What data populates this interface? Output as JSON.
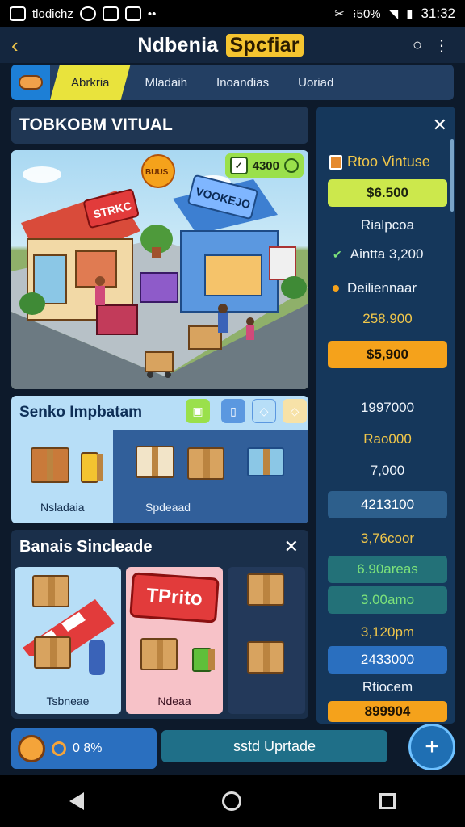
{
  "status_bar": {
    "app_label": "tlodichz",
    "battery": "⁝50%",
    "time": "31:32"
  },
  "header": {
    "title_main": "Ndbenia",
    "title_highlight": "Spcfiar"
  },
  "tabs": [
    {
      "label": "Abrkria"
    },
    {
      "label": "Mladaih"
    },
    {
      "label": "Inoandias"
    },
    {
      "label": "Uoriad"
    }
  ],
  "main": {
    "section_title": "TOBKOBM VITUAL",
    "scene": {
      "currency": "4300",
      "shop_sign": "STRKC",
      "sun_badge": "BUUS",
      "store_sign": "VOOKEJO"
    },
    "panel_a": {
      "title": "Senko Impbatam",
      "label_left": "Nsladaia",
      "label_right": "Spdeaad"
    },
    "panel_b": {
      "title": "Banais Sincleade",
      "badge": "TPrito",
      "label_left": "Tsbneae",
      "label_mid": "Ndeaa"
    }
  },
  "sidebar": {
    "title": "Rtoo Vintuse",
    "rows": [
      "$6.500",
      "Rialpcoa",
      "Aintta 3,200",
      "Deiliennaar",
      "258.900",
      "$5,900",
      "1997000",
      "Rao000",
      "7,000",
      "4213100",
      "3,76coor",
      "6.90areas",
      "3.00amo",
      "3,120pm",
      "2433000",
      "Rtiocem",
      "899904"
    ]
  },
  "bottom": {
    "coin_value": "0 8%",
    "upgrade_label": "sstd Uprtade"
  },
  "colors": {
    "accent_yellow": "#e9e33c",
    "accent_green": "#cce84c",
    "accent_orange": "#f5a21b",
    "panel_dark": "#15375b"
  }
}
